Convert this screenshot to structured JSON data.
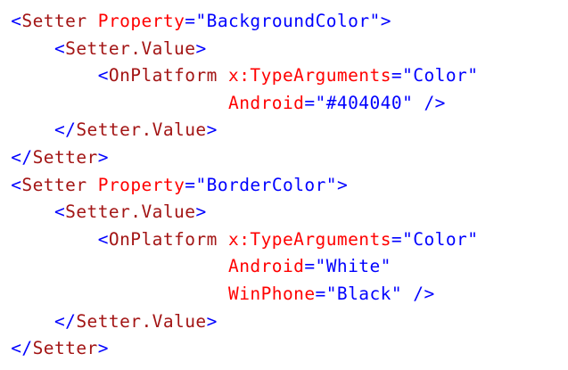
{
  "code": {
    "lines": [
      {
        "indent": 1,
        "tokens": [
          {
            "t": "<",
            "k": "bracket"
          },
          {
            "t": "Setter",
            "k": "element"
          },
          {
            "t": " ",
            "k": "text"
          },
          {
            "t": "Property",
            "k": "attr"
          },
          {
            "t": "=",
            "k": "bracket"
          },
          {
            "t": "\"BackgroundColor\"",
            "k": "value"
          },
          {
            "t": ">",
            "k": "bracket"
          }
        ]
      },
      {
        "indent": 5,
        "tokens": [
          {
            "t": "<",
            "k": "bracket"
          },
          {
            "t": "Setter.Value",
            "k": "element"
          },
          {
            "t": ">",
            "k": "bracket"
          }
        ]
      },
      {
        "indent": 9,
        "tokens": [
          {
            "t": "<",
            "k": "bracket"
          },
          {
            "t": "OnPlatform",
            "k": "element"
          },
          {
            "t": " ",
            "k": "text"
          },
          {
            "t": "x:TypeArguments",
            "k": "attr"
          },
          {
            "t": "=",
            "k": "bracket"
          },
          {
            "t": "\"Color\"",
            "k": "value"
          }
        ]
      },
      {
        "indent": 21,
        "tokens": [
          {
            "t": "Android",
            "k": "attr"
          },
          {
            "t": "=",
            "k": "bracket"
          },
          {
            "t": "\"#404040\"",
            "k": "value"
          },
          {
            "t": " ",
            "k": "text"
          },
          {
            "t": "/>",
            "k": "bracket"
          }
        ]
      },
      {
        "indent": 5,
        "tokens": [
          {
            "t": "</",
            "k": "bracket"
          },
          {
            "t": "Setter.Value",
            "k": "element"
          },
          {
            "t": ">",
            "k": "bracket"
          }
        ]
      },
      {
        "indent": 1,
        "tokens": [
          {
            "t": "</",
            "k": "bracket"
          },
          {
            "t": "Setter",
            "k": "element"
          },
          {
            "t": ">",
            "k": "bracket"
          }
        ]
      },
      {
        "indent": 1,
        "tokens": [
          {
            "t": "<",
            "k": "bracket"
          },
          {
            "t": "Setter",
            "k": "element"
          },
          {
            "t": " ",
            "k": "text"
          },
          {
            "t": "Property",
            "k": "attr"
          },
          {
            "t": "=",
            "k": "bracket"
          },
          {
            "t": "\"BorderColor\"",
            "k": "value"
          },
          {
            "t": ">",
            "k": "bracket"
          }
        ]
      },
      {
        "indent": 5,
        "tokens": [
          {
            "t": "<",
            "k": "bracket"
          },
          {
            "t": "Setter.Value",
            "k": "element"
          },
          {
            "t": ">",
            "k": "bracket"
          }
        ]
      },
      {
        "indent": 9,
        "tokens": [
          {
            "t": "<",
            "k": "bracket"
          },
          {
            "t": "OnPlatform",
            "k": "element"
          },
          {
            "t": " ",
            "k": "text"
          },
          {
            "t": "x:TypeArguments",
            "k": "attr"
          },
          {
            "t": "=",
            "k": "bracket"
          },
          {
            "t": "\"Color\"",
            "k": "value"
          }
        ]
      },
      {
        "indent": 21,
        "tokens": [
          {
            "t": "Android",
            "k": "attr"
          },
          {
            "t": "=",
            "k": "bracket"
          },
          {
            "t": "\"White\"",
            "k": "value"
          }
        ]
      },
      {
        "indent": 21,
        "tokens": [
          {
            "t": "WinPhone",
            "k": "attr"
          },
          {
            "t": "=",
            "k": "bracket"
          },
          {
            "t": "\"Black\"",
            "k": "value"
          },
          {
            "t": " ",
            "k": "text"
          },
          {
            "t": "/>",
            "k": "bracket"
          }
        ]
      },
      {
        "indent": 5,
        "tokens": [
          {
            "t": "</",
            "k": "bracket"
          },
          {
            "t": "Setter.Value",
            "k": "element"
          },
          {
            "t": ">",
            "k": "bracket"
          }
        ]
      },
      {
        "indent": 1,
        "tokens": [
          {
            "t": "</",
            "k": "bracket"
          },
          {
            "t": "Setter",
            "k": "element"
          },
          {
            "t": ">",
            "k": "bracket"
          }
        ]
      }
    ]
  }
}
